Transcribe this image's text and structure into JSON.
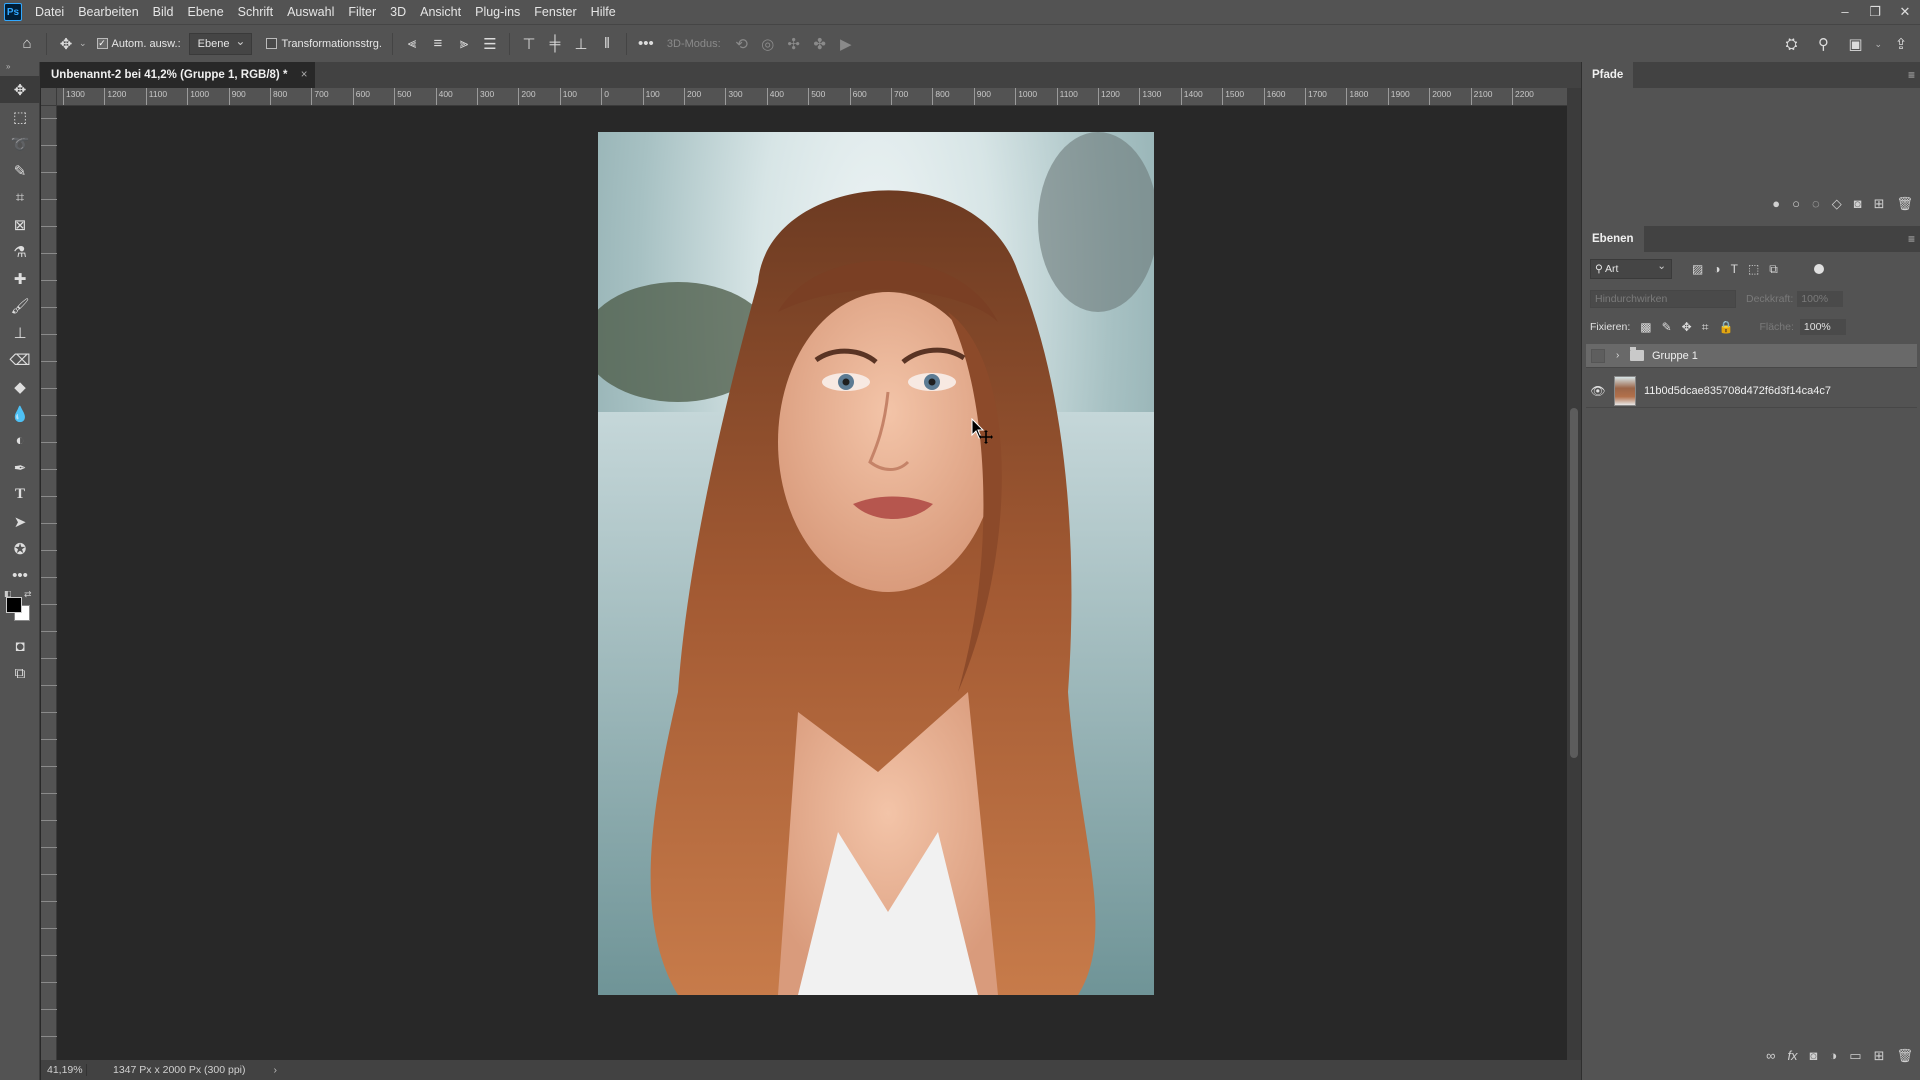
{
  "app": {
    "logo": "Ps",
    "menu": [
      "Datei",
      "Bearbeiten",
      "Bild",
      "Ebene",
      "Schrift",
      "Auswahl",
      "Filter",
      "3D",
      "Ansicht",
      "Plug-ins",
      "Fenster",
      "Hilfe"
    ],
    "window_controls": [
      "–",
      "❐",
      "✕"
    ]
  },
  "options_bar": {
    "auto_select_label": "Autom. ausw.:",
    "auto_select_checked": true,
    "auto_select_target": "Ebene",
    "transform_label": "Transformationsstrg.",
    "transform_checked": false,
    "three_d_mode": "3D-Modus:"
  },
  "document": {
    "tab_title": "Unbenannt-2 bei 41,2% (Gruppe 1, RGB/8) *",
    "close": "×"
  },
  "ruler": {
    "h_labels": [
      "1300",
      "1200",
      "1100",
      "1000",
      "900",
      "800",
      "700",
      "600",
      "500",
      "400",
      "300",
      "200",
      "100",
      "0",
      "100",
      "200",
      "300",
      "400",
      "500",
      "600",
      "700",
      "800",
      "900",
      "1000",
      "1100",
      "1200",
      "1300",
      "1400",
      "1500",
      "1600",
      "1700",
      "1800",
      "1900",
      "2000",
      "2100",
      "2200"
    ]
  },
  "status_bar": {
    "zoom": "41,19%",
    "doc_info": "1347 Px x 2000 Px (300 ppi)",
    "arrow": "›"
  },
  "panels": {
    "paths": {
      "title": "Pfade"
    },
    "layers": {
      "title": "Ebenen",
      "filter_kind": "Art",
      "blend_mode": "Hindurchwirken",
      "opacity_label": "Deckkraft:",
      "opacity_value": "100%",
      "lock_label": "Fixieren:",
      "fill_label": "Fläche:",
      "fill_value": "100%",
      "items": [
        {
          "name": "Gruppe 1",
          "type": "group",
          "visible": false,
          "selected": true
        },
        {
          "name": "11b0d5dcae835708d472f6d3f14ca4c7",
          "type": "pixel",
          "visible": true,
          "selected": false
        }
      ]
    }
  },
  "colors": {
    "ui_panel": "#535353",
    "canvas_bg": "#282828",
    "foreground": "#000000",
    "background": "#ffffff",
    "ps_accent": "#31a8ff"
  }
}
